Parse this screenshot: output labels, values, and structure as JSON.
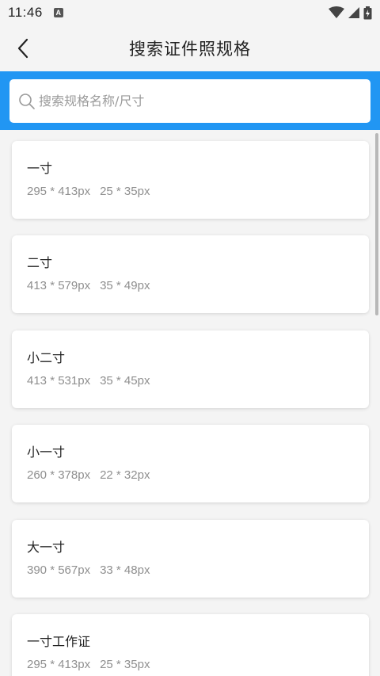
{
  "status_bar": {
    "time": "11:46",
    "notification_icon": "a-icon",
    "icons": [
      "wifi-icon",
      "signal-icon",
      "battery-charging-icon"
    ]
  },
  "header": {
    "back_icon": "chevron-left-icon",
    "title": "搜索证件照规格"
  },
  "search": {
    "icon": "search-icon",
    "placeholder": "搜索规格名称/尺寸",
    "value": ""
  },
  "colors": {
    "accent": "#2196f3",
    "background": "#f4f4f4",
    "card": "#ffffff",
    "secondary_text": "#8f8f8f"
  },
  "specs": [
    {
      "name": "一寸",
      "pixels": "295 * 413px",
      "mm": "25 * 35px"
    },
    {
      "name": "二寸",
      "pixels": "413 * 579px",
      "mm": "35 * 49px"
    },
    {
      "name": "小二寸",
      "pixels": "413 * 531px",
      "mm": "35 * 45px"
    },
    {
      "name": "小一寸",
      "pixels": "260 * 378px",
      "mm": "22 * 32px"
    },
    {
      "name": "大一寸",
      "pixels": "390 * 567px",
      "mm": "33 * 48px"
    },
    {
      "name": "一寸工作证",
      "pixels": "295 * 413px",
      "mm": "25 * 35px"
    }
  ]
}
